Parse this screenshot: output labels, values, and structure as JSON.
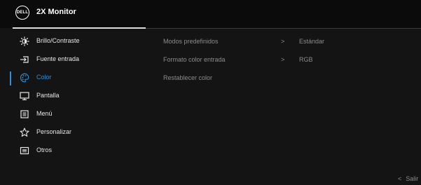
{
  "header": {
    "logo_text": "DELL",
    "title": "2X Monitor"
  },
  "sidebar": {
    "items": [
      {
        "label": "Brillo/Contraste",
        "icon": "brightness-icon",
        "active": false
      },
      {
        "label": "Fuente entrada",
        "icon": "input-source-icon",
        "active": false
      },
      {
        "label": "Color",
        "icon": "color-palette-icon",
        "active": true
      },
      {
        "label": "Pantalla",
        "icon": "display-icon",
        "active": false
      },
      {
        "label": "Menú",
        "icon": "menu-icon",
        "active": false
      },
      {
        "label": "Personalizar",
        "icon": "star-icon",
        "active": false
      },
      {
        "label": "Otros",
        "icon": "others-icon",
        "active": false
      }
    ]
  },
  "detail": {
    "rows": [
      {
        "label": "Modos predefinidos",
        "chevron": ">",
        "value": "Estándar"
      },
      {
        "label": "Formato color entrada",
        "chevron": ">",
        "value": "RGB"
      },
      {
        "label": "Restablecer color",
        "chevron": "",
        "value": ""
      }
    ]
  },
  "footer": {
    "exit_arrow": "<",
    "exit_label": "Salir"
  },
  "colors": {
    "accent": "#2f8fd8",
    "background": "#141414",
    "text": "#e6e6e6",
    "muted_text": "#8c8c8c"
  }
}
